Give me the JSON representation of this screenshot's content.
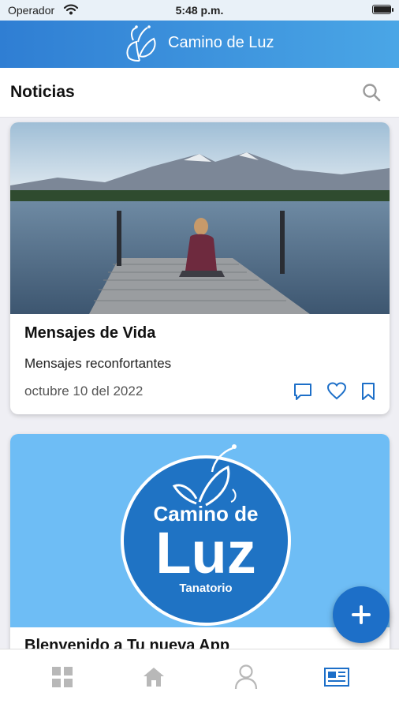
{
  "status_bar": {
    "carrier": "Operador",
    "time": "5:48 p.m.",
    "battery_level": 0.95
  },
  "app_bar": {
    "title": "Camino de Luz",
    "logo_icon": "butterfly-icon"
  },
  "section": {
    "title": "Noticias",
    "search_icon": "search-icon"
  },
  "posts": [
    {
      "title": "Mensajes de Vida",
      "subtitle": "Mensajes reconfortantes",
      "date": "octubre 10 del 2022",
      "image": "lake-dock-photo",
      "actions": [
        "comment-icon",
        "heart-icon",
        "bookmark-icon"
      ]
    },
    {
      "title": "Blenvenido a Tu nueva App",
      "image_logo": {
        "line1": "Camino de",
        "line2": "Luz",
        "line3": "Tanatorio"
      }
    }
  ],
  "fab": {
    "icon": "plus-icon"
  },
  "tabs": [
    {
      "icon": "grid-icon",
      "active": false
    },
    {
      "icon": "home-icon",
      "active": false
    },
    {
      "icon": "user-icon",
      "active": false
    },
    {
      "icon": "news-icon",
      "active": true
    }
  ],
  "colors": {
    "accent": "#1d6fc8",
    "header_start": "#2f7ed3",
    "header_end": "#4aa6e6",
    "tab_inactive": "#b8b8b8",
    "tab_active": "#1d6fc8",
    "logo_bg": "#6ebdf5"
  }
}
